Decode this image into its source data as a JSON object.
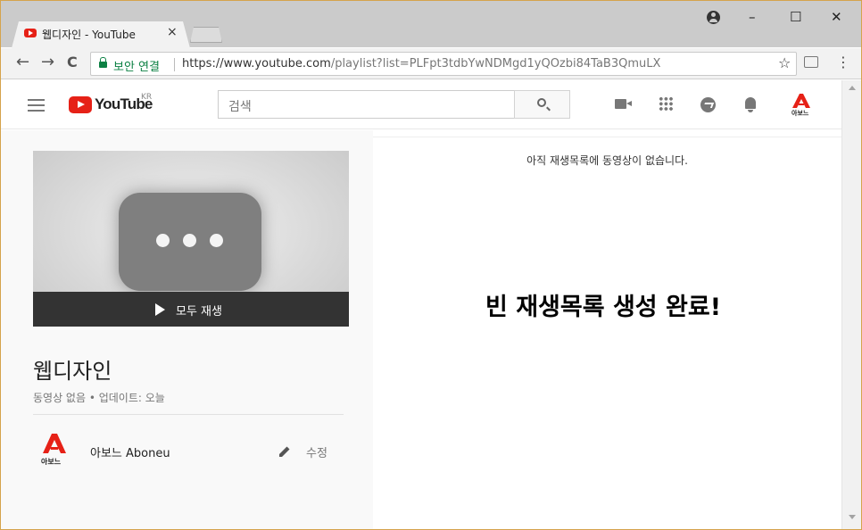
{
  "browser": {
    "tab_title": "웹디자인 - YouTube",
    "tab_close": "×",
    "window_controls": {
      "minimize": "–",
      "maximize": "☐",
      "close": "✕"
    },
    "nav": {
      "back": "←",
      "forward": "→",
      "reload": "C"
    },
    "secure_label": "보안 연결",
    "url_host": "https://www.youtube.com",
    "url_path": "/playlist?list=PLFpt3tdbYwNDMgd1yQOzbi84TaB3QmuLX",
    "bookmark_star": "☆",
    "menu": "⋮",
    "icons": [
      "profile-icon",
      "lock-icon",
      "star-icon",
      "extension-icon",
      "menu-dots-icon"
    ]
  },
  "youtube_header": {
    "logo_text": "YouTube",
    "country_code": "KR",
    "search_placeholder": "검색",
    "account_label": "아보느",
    "icons": [
      "hamburger-menu-icon",
      "search-icon",
      "upload-video-icon",
      "apps-grid-icon",
      "messages-icon",
      "notifications-bell-icon"
    ],
    "brand_color": "#e62117"
  },
  "playlist": {
    "play_all_label": "모두 재생",
    "title": "웹디자인",
    "meta": "동영상 없음 • 업데이트: 오늘",
    "owner_name": "아보느 Aboneu",
    "owner_avatar_label": "아보느",
    "edit_label": "수정"
  },
  "content": {
    "empty_message": "아직 재생목록에 동영상이 없습니다.",
    "overlay_message": "빈 재생목록 생성 완료!"
  }
}
